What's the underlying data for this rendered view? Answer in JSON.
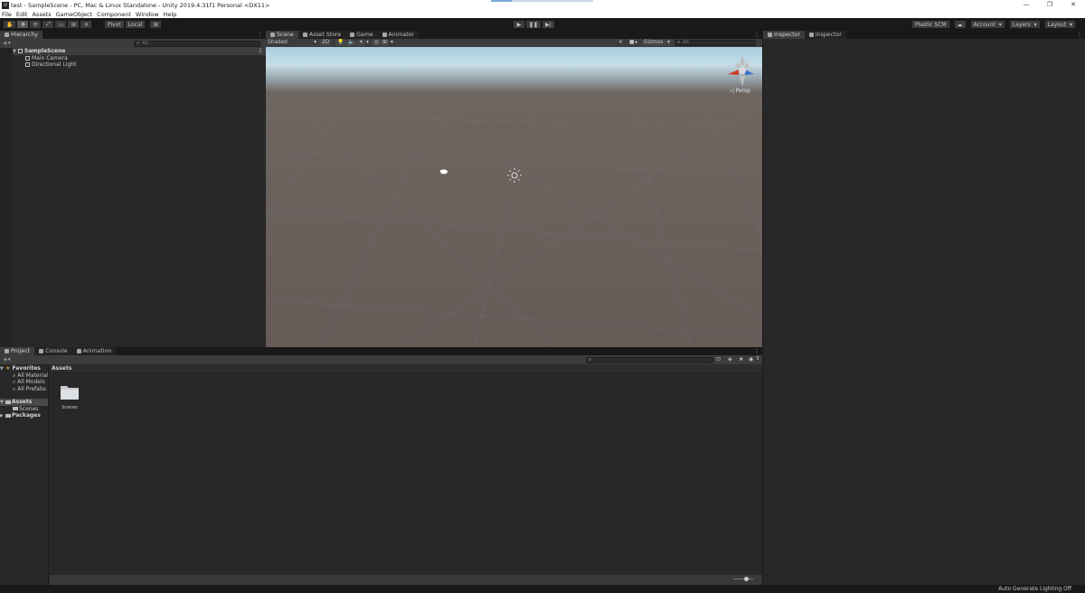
{
  "window": {
    "title": "test - SampleScene - PC, Mac & Linux Standalone - Unity 2019.4.31f1 Personal <DX11>",
    "app_icon_text": "U",
    "controls": [
      "—",
      "❐",
      "✕"
    ]
  },
  "menu": [
    "File",
    "Edit",
    "Assets",
    "GameObject",
    "Component",
    "Window",
    "Help"
  ],
  "toolbar": {
    "tools": [
      "✋",
      "✥",
      "⟳",
      "⤢",
      "▭",
      "⊞",
      "✕"
    ],
    "pivot_label": "Pivot",
    "local_label": "Local",
    "grid_snap": "⊞",
    "play": "▶",
    "pause": "❚❚",
    "step": "▶|",
    "plastic_label": "Plastic SCM",
    "cloud": "☁",
    "account_label": "Account",
    "layers_label": "Layers",
    "layout_label": "Layout"
  },
  "hierarchy": {
    "tab_label": "Hierarchy",
    "add_button": "+",
    "search_placeholder": "All",
    "lock": "🔒",
    "scene_name": "SampleScene",
    "items": [
      "Main Camera",
      "Directional Light"
    ]
  },
  "scene": {
    "tabs": [
      "Scene",
      "Asset Store",
      "Game",
      "Animator"
    ],
    "shading_label": "Shaded",
    "mode_2d_label": "2D",
    "gizmos_label": "Gizmos",
    "search_placeholder": "All",
    "persp_label": "◁ Persp"
  },
  "inspector": {
    "tabs": [
      "Inspector",
      "Inspector"
    ]
  },
  "project": {
    "tabs": [
      "Project",
      "Console",
      "Animation"
    ],
    "add_button": "+",
    "favorites_label": "Favorites",
    "favorites": [
      "All Material",
      "All Models",
      "All Prefabs"
    ],
    "assets_label": "Assets",
    "assets_children": [
      "Scenes"
    ],
    "packages_label": "Packages",
    "breadcrumb": "Assets",
    "folder_name": "Scenes",
    "hidden_count": "3"
  },
  "status": {
    "text": "Auto Generate Lighting Off"
  },
  "colors": {
    "panel_bg": "#282828",
    "tab_active": "#3c3c3c",
    "window_bg": "#191919",
    "sky": "#c5dde6",
    "ground": "#665b57"
  }
}
